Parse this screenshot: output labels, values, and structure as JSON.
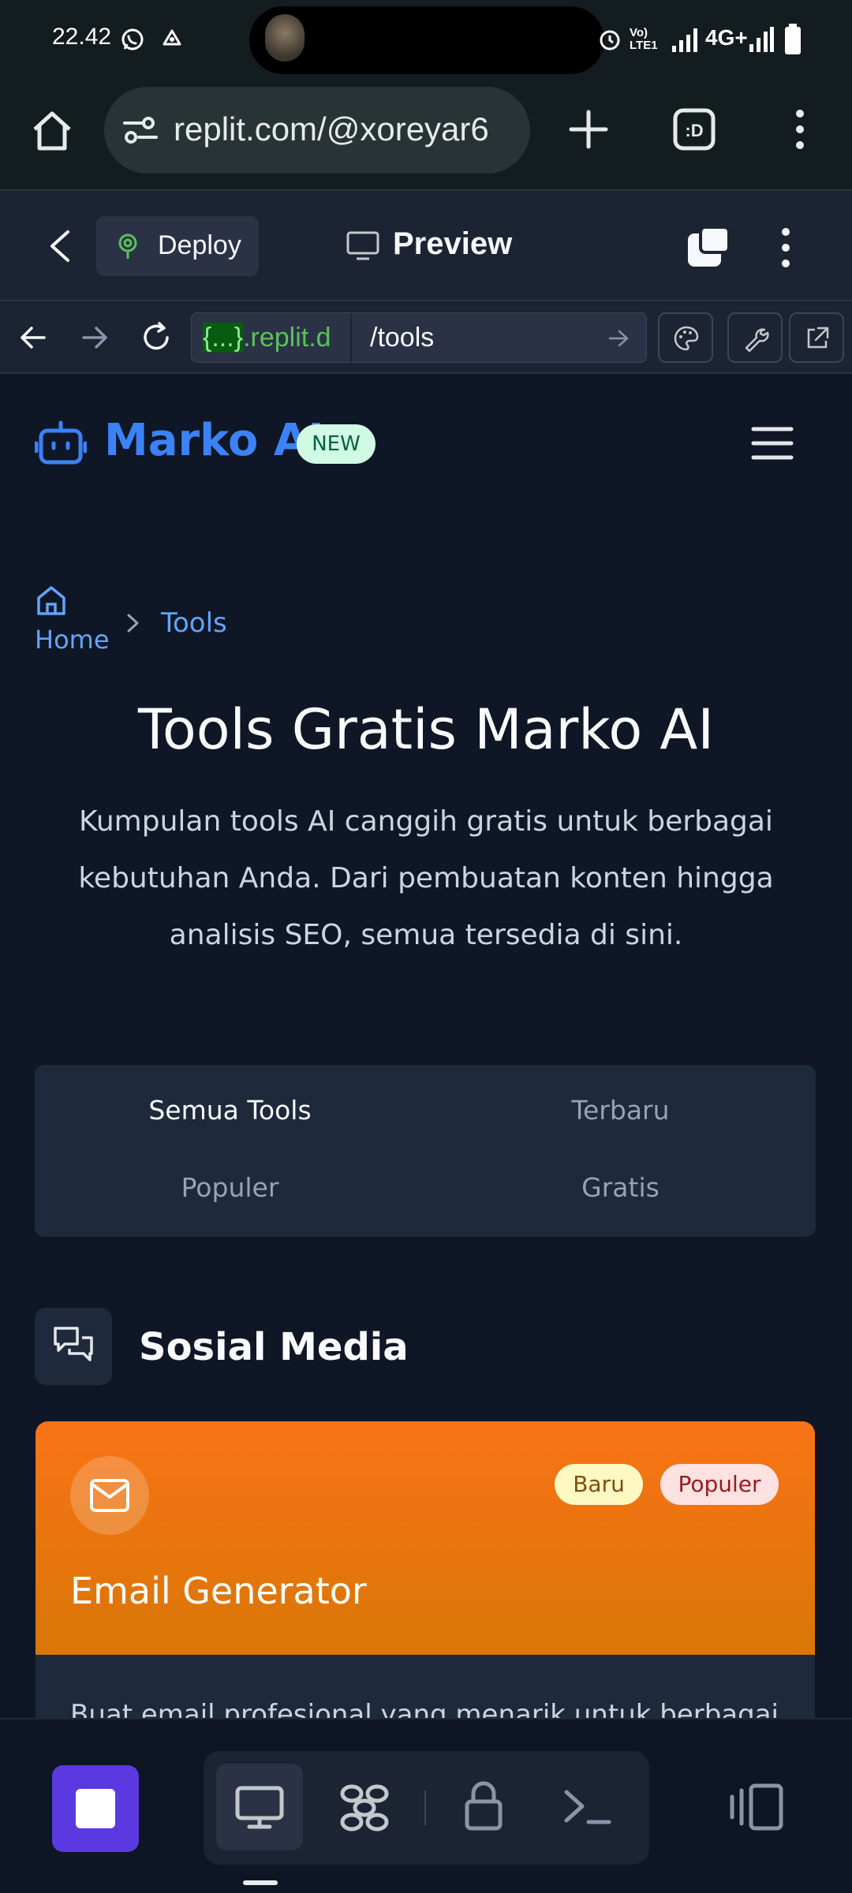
{
  "status_bar": {
    "time": "22.42",
    "network": "4G+",
    "volte": "Vo) LTE1"
  },
  "browser": {
    "url": "replit.com/@xoreyar6"
  },
  "replit_bar": {
    "deploy_label": "Deploy",
    "preview_label": "Preview"
  },
  "nav_bar": {
    "host_prefix": "{...}",
    "host_suffix": ".replit.d",
    "path": "/tools"
  },
  "site": {
    "brand_name": "Marko AI",
    "brand_badge": "NEW",
    "breadcrumb": {
      "home": "Home",
      "current": "Tools"
    },
    "title": "Tools Gratis Marko AI",
    "description": "Kumpulan tools AI canggih gratis untuk berbagai kebutuhan Anda. Dari pembuatan konten hingga analisis SEO, semua tersedia di sini.",
    "filters": {
      "all": "Semua Tools",
      "newest": "Terbaru",
      "popular": "Populer",
      "free": "Gratis",
      "active": "all"
    },
    "section_title": "Sosial Media",
    "card": {
      "title": "Email Generator",
      "badge_new": "Baru",
      "badge_popular": "Populer",
      "description": "Buat email profesional yang menarik untuk berbagai"
    }
  },
  "colors": {
    "brand": "#3b82f6",
    "card_gradient_start": "#f97316",
    "card_gradient_end": "#d97706",
    "app_icon": "#5a3ae0"
  }
}
